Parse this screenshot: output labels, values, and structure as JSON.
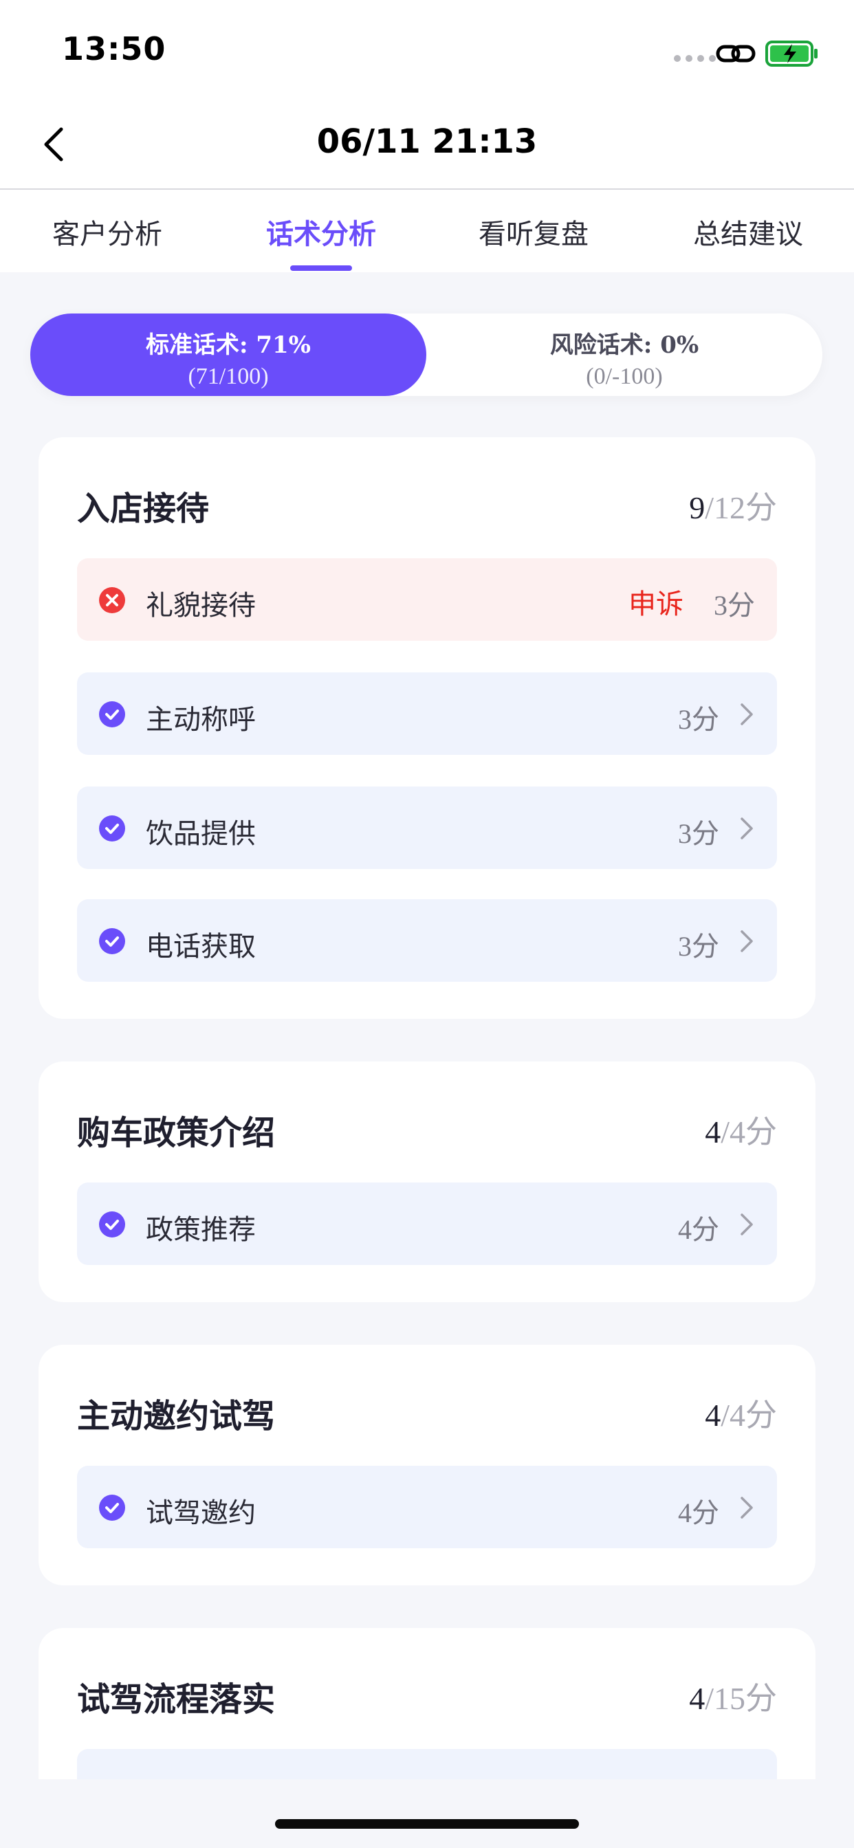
{
  "status_bar": {
    "time": "13:50",
    "signal_icon": "signal-dots-icon",
    "link_icon": "link-icon",
    "battery_icon": "battery-charging-icon"
  },
  "nav": {
    "title": "06/11 21:13",
    "back_icon": "chevron-left-icon"
  },
  "tabs": [
    {
      "label": "客户分析",
      "active": false
    },
    {
      "label": "话术分析",
      "active": true
    },
    {
      "label": "看听复盘",
      "active": false
    },
    {
      "label": "总结建议",
      "active": false
    }
  ],
  "segment": {
    "standard": {
      "label": "标准话术: 71%",
      "sub": "(71/100)"
    },
    "risk": {
      "label": "风险话术: 0%",
      "sub": "(0/-100)"
    }
  },
  "cards": [
    {
      "title": "入店接待",
      "score": "9",
      "total": "/12分",
      "items": [
        {
          "label": "礼貌接待",
          "score": "3分",
          "status": "fail",
          "appeal": "申诉"
        },
        {
          "label": "主动称呼",
          "score": "3分",
          "status": "pass"
        },
        {
          "label": "饮品提供",
          "score": "3分",
          "status": "pass"
        },
        {
          "label": "电话获取",
          "score": "3分",
          "status": "pass"
        }
      ]
    },
    {
      "title": "购车政策介绍",
      "score": "4",
      "total": "/4分",
      "items": [
        {
          "label": "政策推荐",
          "score": "4分",
          "status": "pass"
        }
      ]
    },
    {
      "title": "主动邀约试驾",
      "score": "4",
      "total": "/4分",
      "items": [
        {
          "label": "试驾邀约",
          "score": "4分",
          "status": "pass"
        }
      ]
    },
    {
      "title": "试驾流程落实",
      "score": "4",
      "total": "/15分",
      "items": []
    }
  ],
  "colors": {
    "accent": "#6a4dfa",
    "fail": "#e8251c",
    "fail_bg": "#fdf0f0",
    "item_bg": "#eff3fd"
  }
}
